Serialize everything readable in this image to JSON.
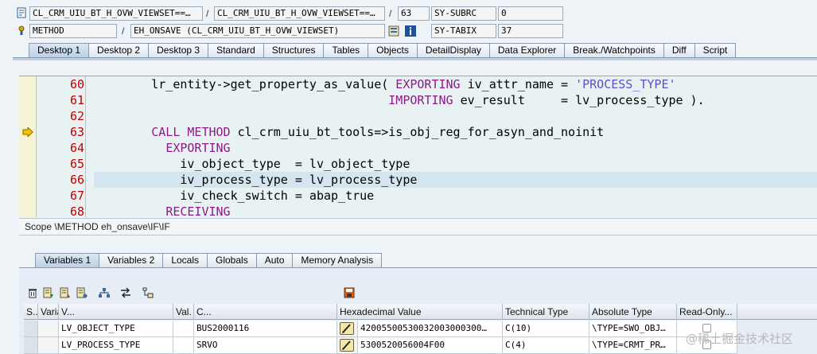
{
  "header": {
    "program_field": "CL_CRM_UIU_BT_H_OVW_VIEWSET==…",
    "include_field": "CL_CRM_UIU_BT_H_OVW_VIEWSET==…",
    "line_field": "63",
    "sy_subrc_label": "SY-SUBRC",
    "sy_subrc_value": "0",
    "event_type_field": "METHOD",
    "event_field": "EH_ONSAVE (CL_CRM_UIU_BT_H_OVW_VIEWSET)",
    "sy_tabix_label": "SY-TABIX",
    "sy_tabix_value": "37",
    "slash": "/"
  },
  "tabs": [
    "Desktop 1",
    "Desktop 2",
    "Desktop 3",
    "Standard",
    "Structures",
    "Tables",
    "Objects",
    "DetailDisplay",
    "Data Explorer",
    "Break./Watchpoints",
    "Diff",
    "Script"
  ],
  "code_lines": [
    {
      "num": "60",
      "segments": [
        {
          "t": "        lr_entity->get_property_as_value( ",
          "c": ""
        },
        {
          "t": "EXPORTING",
          "c": "kw"
        },
        {
          "t": " iv_attr_name = ",
          "c": ""
        },
        {
          "t": "'PROCESS_TYPE'",
          "c": "str"
        }
      ]
    },
    {
      "num": "61",
      "segments": [
        {
          "t": "                                         ",
          "c": ""
        },
        {
          "t": "IMPORTING",
          "c": "kw"
        },
        {
          "t": " ev_result     = lv_process_type ).",
          "c": ""
        }
      ]
    },
    {
      "num": "62",
      "segments": []
    },
    {
      "num": "63",
      "segments": [
        {
          "t": "        ",
          "c": ""
        },
        {
          "t": "CALL METHOD",
          "c": "kw"
        },
        {
          "t": " cl_crm_uiu_bt_tools=>is_obj_reg_for_asyn_and_noinit",
          "c": ""
        }
      ]
    },
    {
      "num": "64",
      "segments": [
        {
          "t": "          ",
          "c": ""
        },
        {
          "t": "EXPORTING",
          "c": "kw"
        }
      ]
    },
    {
      "num": "65",
      "segments": [
        {
          "t": "            iv_object_type  = lv_object_type",
          "c": ""
        }
      ]
    },
    {
      "num": "66",
      "segments": [
        {
          "t": "            iv_process_type = lv_process_type",
          "c": ""
        }
      ]
    },
    {
      "num": "67",
      "segments": [
        {
          "t": "            iv_check_switch = abap_true",
          "c": ""
        }
      ]
    },
    {
      "num": "68",
      "segments": [
        {
          "t": "          ",
          "c": ""
        },
        {
          "t": "RECEIVING",
          "c": "kw"
        }
      ]
    }
  ],
  "scope_text": "Scope \\METHOD eh_onsave\\IF\\IF",
  "var_tabs": [
    "Variables 1",
    "Variables 2",
    "Locals",
    "Globals",
    "Auto",
    "Memory Analysis"
  ],
  "table": {
    "headers": [
      "S...",
      "Variable",
      "V...",
      "Val.",
      "C...",
      "Hexadecimal Value",
      "Technical Type",
      "Absolute Type",
      "Read-Only..."
    ],
    "rows": [
      {
        "variable": "LV_OBJECT_TYPE",
        "value": "BUS2000116",
        "hex": "42005500530032003000300…",
        "tech": "C(10)",
        "abs": "\\TYPE=SWO_OBJ…"
      },
      {
        "variable": "LV_PROCESS_TYPE",
        "value": "SRVO",
        "hex": "5300520056004F00",
        "tech": "C(4)",
        "abs": "\\TYPE=CRMT_PR…"
      }
    ]
  },
  "watermark": "@稀土掘金技术社区",
  "colors": {
    "keyword": "#8b1a8b",
    "string": "#5a4fd0",
    "line_number": "#c00000"
  }
}
